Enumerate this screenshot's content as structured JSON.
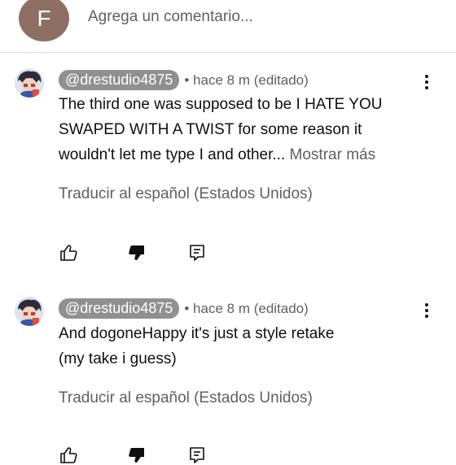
{
  "composer": {
    "avatar_letter": "F",
    "placeholder": "Agrega un comentario..."
  },
  "comments": [
    {
      "handle": "@drestudio4875",
      "time": "• hace 8 m (editado)",
      "text_lines": [
        "The third one was supposed to be I HATE YOU",
        "SWAPED WITH A TWIST for some reason it",
        "wouldn't let me type I and other..."
      ],
      "more_label": "Mostrar más",
      "translate_label": "Traducir al español (Estados Unidos)",
      "icons": [
        "like-icon",
        "dislike-icon",
        "reply-icon",
        "more-vert-icon"
      ]
    },
    {
      "handle": "@drestudio4875",
      "time": "• hace 8 m (editado)",
      "text_lines": [
        "And dogoneHappy it's just a style retake",
        "(my take i guess)"
      ],
      "translate_label": "Traducir al español (Estados Unidos)",
      "icons": [
        "like-icon",
        "dislike-icon",
        "reply-icon",
        "more-vert-icon"
      ]
    }
  ],
  "colors": {
    "text": "#0f0f0f",
    "secondary": "#606060",
    "handle_bg": "#909090",
    "composer_avatar": "#8d6e63"
  }
}
